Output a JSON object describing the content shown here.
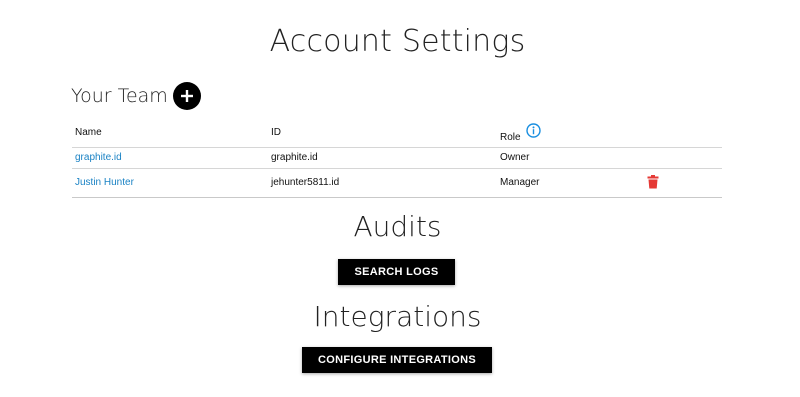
{
  "page": {
    "title": "Account Settings"
  },
  "team": {
    "title": "Your Team",
    "add_icon": "plus-icon",
    "columns": {
      "name": "Name",
      "id": "ID",
      "role": "Role"
    },
    "role_info_icon": "info-icon",
    "rows": [
      {
        "name": "graphite.id",
        "id": "graphite.id",
        "role": "Owner"
      },
      {
        "name": "Justin Hunter",
        "id": "jehunter5811.id",
        "role": "Manager",
        "delete_icon": "trash-icon"
      }
    ]
  },
  "audits": {
    "title": "Audits",
    "button_label": "SEARCH LOGS"
  },
  "integrations": {
    "title": "Integrations",
    "button_label": "CONFIGURE INTEGRATIONS"
  },
  "colors": {
    "link": "#1a82c4",
    "info": "#1a8fe0",
    "delete": "#e53935",
    "button": "#000000"
  }
}
